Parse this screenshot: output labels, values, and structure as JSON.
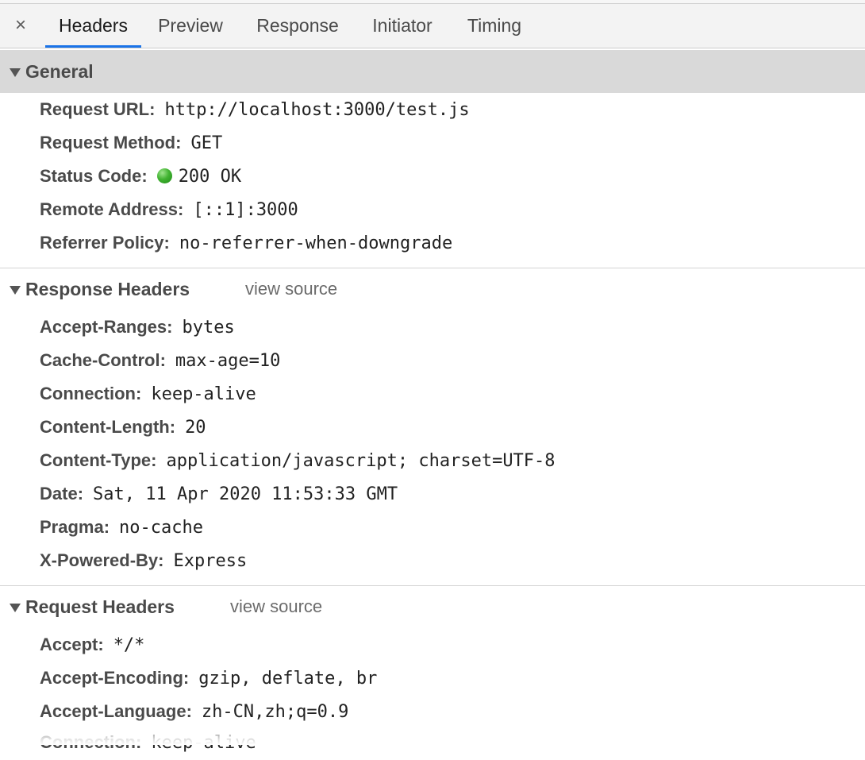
{
  "tabs": {
    "close_label": "×",
    "items": [
      "Headers",
      "Preview",
      "Response",
      "Initiator",
      "Timing"
    ],
    "active": "Headers"
  },
  "general": {
    "title": "General",
    "rows": [
      {
        "key": "Request URL",
        "value": "http://localhost:3000/test.js"
      },
      {
        "key": "Request Method",
        "value": "GET"
      },
      {
        "key": "Status Code",
        "value": "200 OK"
      },
      {
        "key": "Remote Address",
        "value": "[::1]:3000"
      },
      {
        "key": "Referrer Policy",
        "value": "no-referrer-when-downgrade"
      }
    ]
  },
  "response_headers": {
    "title": "Response Headers",
    "view_source": "view source",
    "rows": [
      {
        "key": "Accept-Ranges",
        "value": "bytes"
      },
      {
        "key": "Cache-Control",
        "value": "max-age=10"
      },
      {
        "key": "Connection",
        "value": "keep-alive"
      },
      {
        "key": "Content-Length",
        "value": "20"
      },
      {
        "key": "Content-Type",
        "value": "application/javascript; charset=UTF-8"
      },
      {
        "key": "Date",
        "value": "Sat, 11 Apr 2020 11:53:33 GMT"
      },
      {
        "key": "Pragma",
        "value": "no-cache"
      },
      {
        "key": "X-Powered-By",
        "value": "Express"
      }
    ]
  },
  "request_headers": {
    "title": "Request Headers",
    "view_source": "view source",
    "rows": [
      {
        "key": "Accept",
        "value": "*/*"
      },
      {
        "key": "Accept-Encoding",
        "value": "gzip, deflate, br"
      },
      {
        "key": "Accept-Language",
        "value": "zh-CN,zh;q=0.9"
      },
      {
        "key": "Connection",
        "value": "keep-alive"
      }
    ]
  },
  "colors": {
    "active_tab_underline": "#1a73e8",
    "status_ok": "#41b331",
    "section_header_bg": "#d9d9d9"
  },
  "icons": {
    "close": "close-icon",
    "caret": "triangle-down-icon",
    "status": "status-dot-icon"
  }
}
